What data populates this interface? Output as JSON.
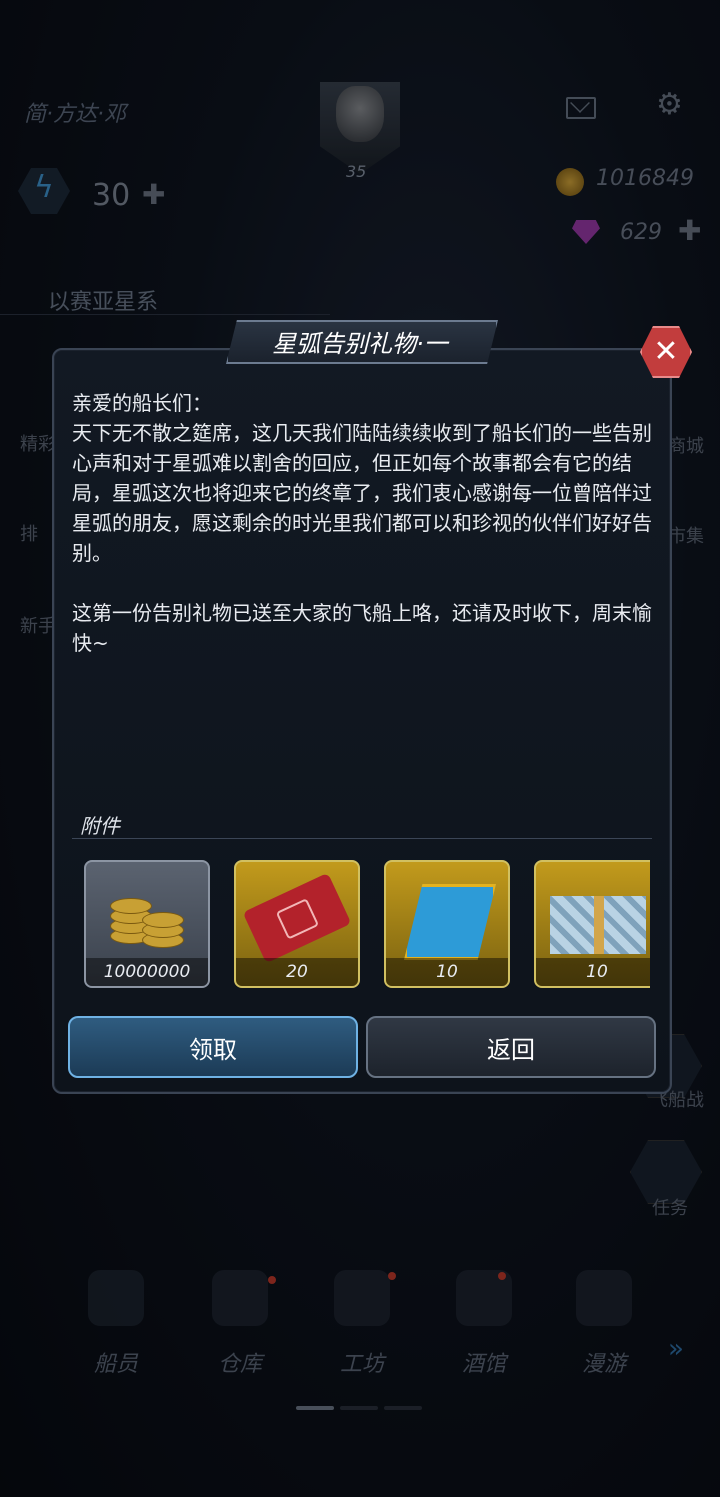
{
  "header": {
    "player_name": "简·方达·邓",
    "level": "35",
    "energy": "30",
    "coins": "1016849",
    "gems": "629",
    "system_name": "以赛亚星系"
  },
  "side_left": [
    "精彩",
    "排",
    "新手"
  ],
  "side_right": [
    "商城",
    "市集",
    "飞船战",
    "任务"
  ],
  "dialog": {
    "title": "星弧告别礼物·一",
    "greeting": "亲爱的船长们：",
    "paragraph1": "天下无不散之筵席，这几天我们陆陆续续收到了船长们的一些告别心声和对于星弧难以割舍的回应，但正如每个故事都会有它的结局，星弧这次也将迎来它的终章了，我们衷心感谢每一位曾陪伴过星弧的朋友，愿这剩余的时光里我们都可以和珍视的伙伴们好好告别。",
    "paragraph2": "这第一份告别礼物已送至大家的飞船上咯，还请及时收下，周末愉快~",
    "attachments_label": "附件",
    "attachments": [
      {
        "icon": "gold-coins-icon",
        "count": "10000000"
      },
      {
        "icon": "red-ticket-icon",
        "count": "20"
      },
      {
        "icon": "crystal-icon",
        "count": "10"
      },
      {
        "icon": "gift-box-icon",
        "count": "10"
      }
    ],
    "claim_label": "领取",
    "back_label": "返回"
  },
  "bottom_nav": [
    "船员",
    "仓库",
    "工坊",
    "酒馆",
    "漫游"
  ],
  "colors": {
    "accent_blue": "#6fb2e4",
    "close_red": "#c23d3d",
    "gold_frame": "#d1c061"
  }
}
